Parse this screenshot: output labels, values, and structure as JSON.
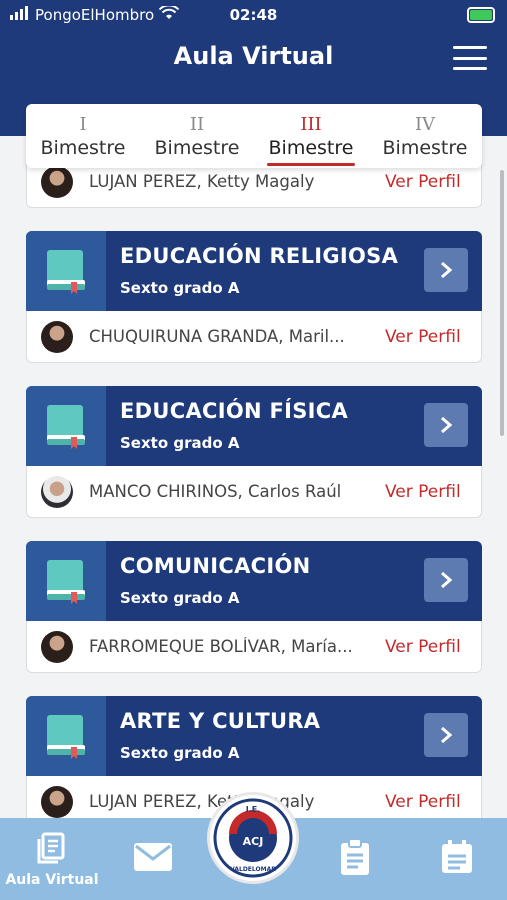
{
  "status_bar": {
    "carrier": "PongoElHombro",
    "time": "02:48"
  },
  "header": {
    "title": "Aula Virtual"
  },
  "tabs": [
    {
      "numeral": "I",
      "label": "Bimestre",
      "active": false
    },
    {
      "numeral": "II",
      "label": "Bimestre",
      "active": false
    },
    {
      "numeral": "III",
      "label": "Bimestre",
      "active": true
    },
    {
      "numeral": "IV",
      "label": "Bimestre",
      "active": false
    }
  ],
  "first_teacher": {
    "name": "LUJAN PEREZ, Ketty Magaly",
    "link": "Ver Perfil"
  },
  "courses": [
    {
      "subject": "EDUCACIÓN RELIGIOSA",
      "grade": "Sexto grado A",
      "teacher": "CHUQUIRUNA GRANDA, Maril...",
      "link": "Ver Perfil"
    },
    {
      "subject": "EDUCACIÓN FÍSICA",
      "grade": "Sexto grado A",
      "teacher": "MANCO CHIRINOS, Carlos Raúl",
      "link": "Ver Perfil"
    },
    {
      "subject": "COMUNICACIÓN",
      "grade": "Sexto grado A",
      "teacher": "FARROMEQUE BOLÍVAR, María...",
      "link": "Ver Perfil"
    },
    {
      "subject": "ARTE Y CULTURA",
      "grade": "Sexto grado A",
      "teacher": "LUJAN PEREZ, Ketty Magaly",
      "link": "Ver Perfil"
    }
  ],
  "bottom_nav": {
    "active_label": "Aula Virtual",
    "logo_text": "I.E. ABRAHAM VALDELOMAR ACJ"
  },
  "colors": {
    "primary": "#1e3a7b",
    "accent": "#c42a2a",
    "book": "#5fc9c0",
    "nav": "#8fbce0"
  }
}
